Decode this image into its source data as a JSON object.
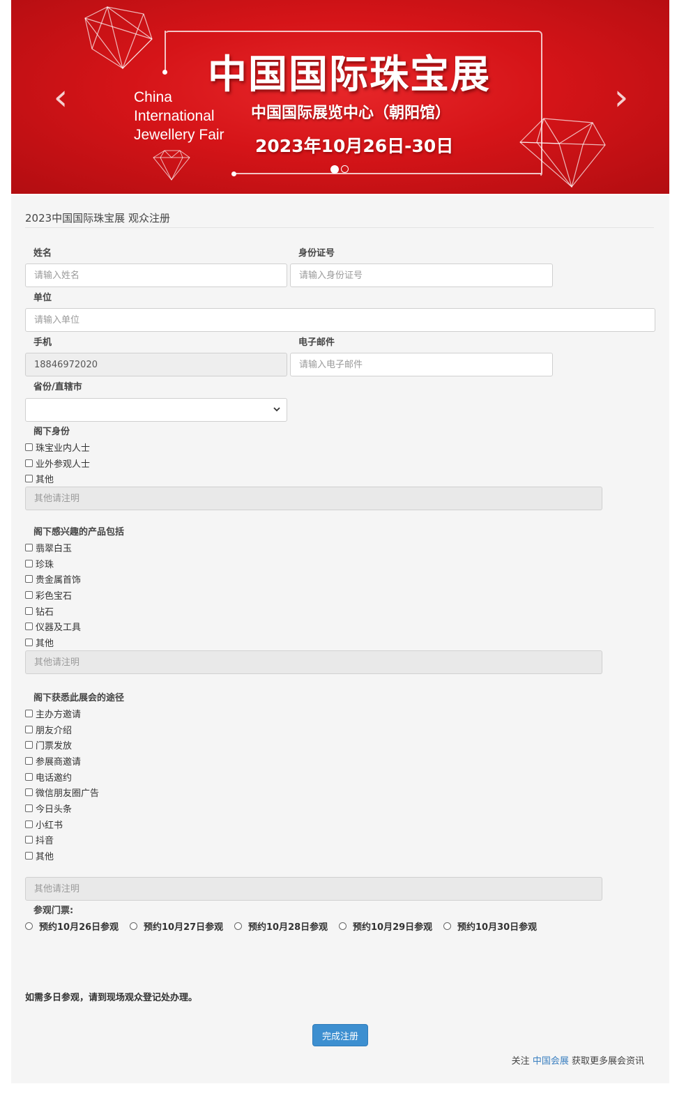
{
  "banner": {
    "title_cn": "中国国际珠宝展",
    "title_en_line1": "China",
    "title_en_line2": "International",
    "title_en_line3": "Jewellery Fair",
    "venue": "中国国际展览中心（朝阳馆）",
    "dates": "2023年10月26日-30日",
    "prev_arrow": "‹",
    "next_arrow": "›",
    "slide_count": 2,
    "active_slide": 1,
    "color_primary": "#d51418"
  },
  "form": {
    "title": "2023中国国际珠宝展 观众注册",
    "name": {
      "label": "姓名",
      "placeholder": "请输入姓名",
      "value": ""
    },
    "id_number": {
      "label": "身份证号",
      "placeholder": "请输入身份证号",
      "value": ""
    },
    "company": {
      "label": "单位",
      "placeholder": "请输入单位",
      "value": ""
    },
    "phone": {
      "label": "手机",
      "value": "18846972020"
    },
    "email": {
      "label": "电子邮件",
      "placeholder": "请输入电子邮件",
      "value": ""
    },
    "province": {
      "label": "省份/直辖市",
      "selected": ""
    },
    "identity": {
      "label": "阁下身份",
      "options": [
        "珠宝业内人士",
        "业外参观人士",
        "其他"
      ],
      "other_placeholder": "其他请注明"
    },
    "products": {
      "label": "阁下感兴趣的产品包括",
      "options": [
        "翡翠白玉",
        "珍珠",
        "贵金属首饰",
        "彩色宝石",
        "钻石",
        "仪器及工具",
        "其他"
      ],
      "other_placeholder": "其他请注明"
    },
    "source": {
      "label": "阁下获悉此展会的途径",
      "options": [
        "主办方邀请",
        "朋友介绍",
        "门票发放",
        "参展商邀请",
        "电话邀约",
        "微信朋友圈广告",
        "今日头条",
        "小红书",
        "抖音",
        "其他"
      ],
      "other_placeholder": "其他请注明"
    },
    "tickets": {
      "label": "参观门票:",
      "options": [
        "预约10月26日参观",
        "预约10月27日参观",
        "预约10月28日参观",
        "预约10月29日参观",
        "预约10月30日参观"
      ]
    },
    "note": "如需多日参观，请到现场观众登记处办理。",
    "submit_label": "完成注册"
  },
  "footer": {
    "prefix": "关注",
    "link": "中国会展",
    "suffix": "获取更多展会资讯",
    "link_color": "#3a7fc0"
  }
}
